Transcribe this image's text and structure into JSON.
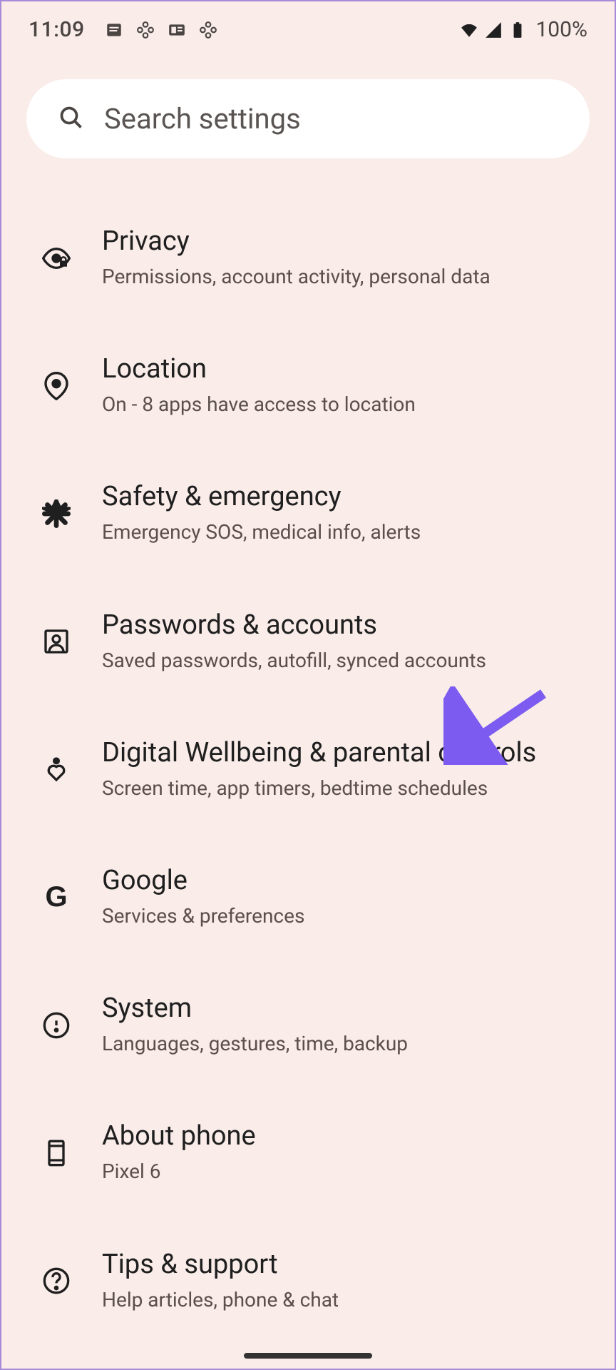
{
  "statusbar": {
    "time": "11:09",
    "battery_text": "100%"
  },
  "search": {
    "placeholder": "Search settings"
  },
  "items": [
    {
      "title": "Privacy",
      "subtitle": "Permissions, account activity, personal data"
    },
    {
      "title": "Location",
      "subtitle": "On - 8 apps have access to location"
    },
    {
      "title": "Safety & emergency",
      "subtitle": "Emergency SOS, medical info, alerts"
    },
    {
      "title": "Passwords & accounts",
      "subtitle": "Saved passwords, autofill, synced accounts"
    },
    {
      "title": "Digital Wellbeing & parental controls",
      "subtitle": "Screen time, app timers, bedtime schedules"
    },
    {
      "title": "Google",
      "subtitle": "Services & preferences"
    },
    {
      "title": "System",
      "subtitle": "Languages, gestures, time, backup"
    },
    {
      "title": "About phone",
      "subtitle": "Pixel 6"
    },
    {
      "title": "Tips & support",
      "subtitle": "Help articles, phone & chat"
    }
  ]
}
